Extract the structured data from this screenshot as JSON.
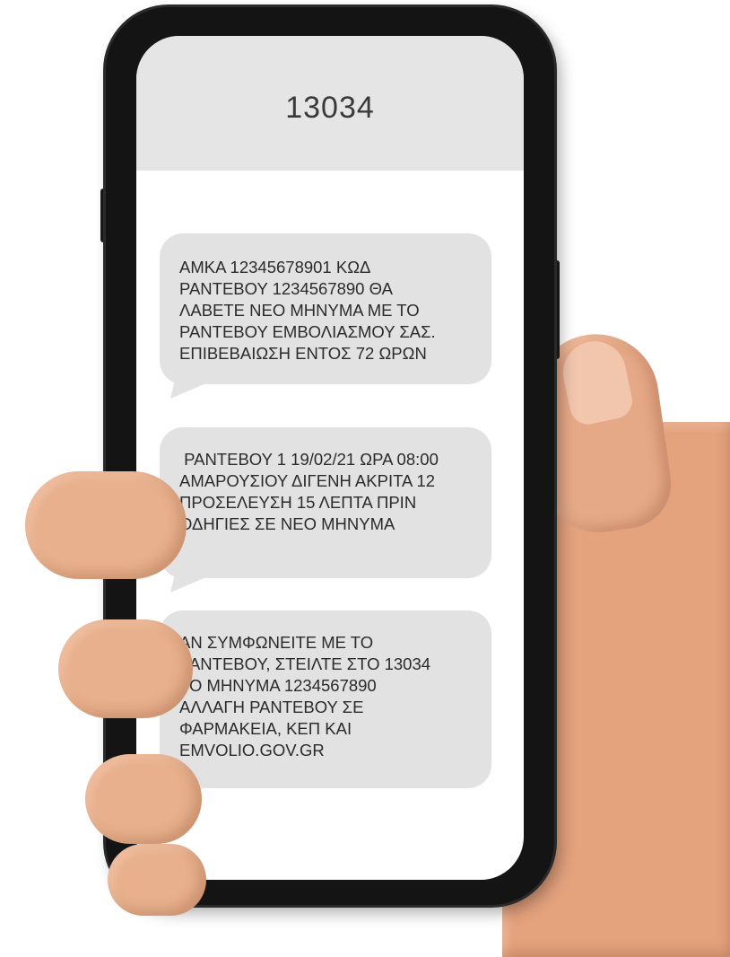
{
  "sms_thread": {
    "sender": "13034",
    "messages": [
      {
        "lines": [
          "ΑΜΚΑ 12345678901 ΚΩΔ",
          "ΡΑΝΤΕΒΟΥ 1234567890 ΘΑ",
          "ΛΑΒΕΤΕ ΝΕΟ ΜΗΝΥΜΑ ΜΕ ΤΟ",
          "ΡΑΝΤΕΒΟΥ ΕΜΒΟΛΙΑΣΜΟΥ ΣΑΣ.",
          "ΕΠΙΒΕΒΑΙΩΣΗ ΕΝΤΟΣ 72 ΩΡΩΝ"
        ]
      },
      {
        "lines": [
          " ΡΑΝΤΕΒΟΥ 1 19/02/21 ΩΡΑ 08:00",
          "ΑΜΑΡΟΥΣΙΟΥ ΔΙΓΕΝΗ ΑΚΡΙΤΑ 12",
          "ΠΡΟΣΕΛΕΥΣΗ 15 ΛΕΠΤΑ ΠΡΙΝ",
          "ΟΔΗΓΙΕΣ ΣΕ ΝΕΟ ΜΗΝΥΜΑ"
        ]
      },
      {
        "lines": [
          "ΑΝ ΣΥΜΦΩΝΕΙΤΕ ΜΕ ΤΟ",
          "ΡΑΝΤΕΒΟΥ, ΣΤΕΙΛΤΕ ΣΤΟ 13034",
          "ΤΟ ΜΗΝΥΜΑ 1234567890",
          "ΑΛΛΑΓΗ ΡΑΝΤΕΒΟΥ ΣΕ",
          "ΦΑΡΜΑΚΕΙΑ, ΚΕΠ ΚΑΙ",
          "EMVOLIO.GOV.GR"
        ]
      }
    ]
  },
  "colors": {
    "header_background": "#e5e5e5",
    "bubble_background": "#e2e2e2",
    "phone_frame": "#141414"
  }
}
